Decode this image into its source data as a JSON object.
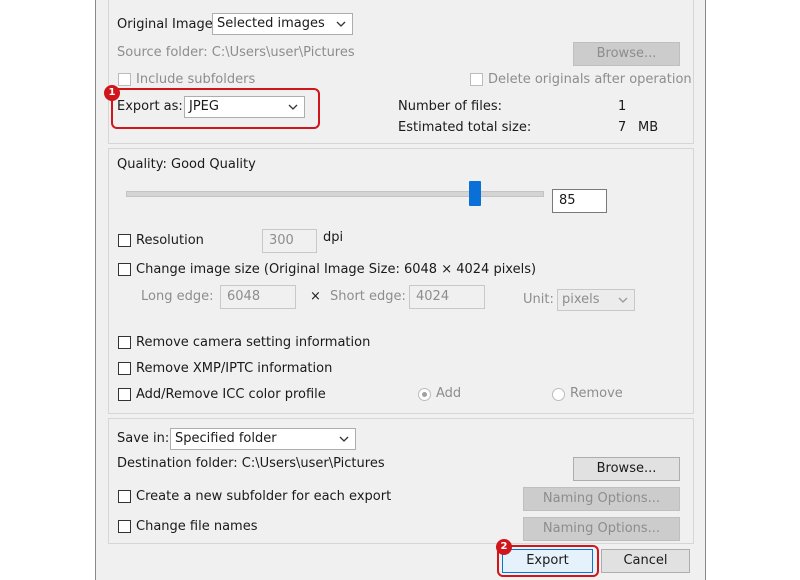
{
  "top": {
    "original_image_label": "Original Image:",
    "original_image_value": "Selected images",
    "source_folder": "Source folder: C:\\Users\\user\\Pictures",
    "browse_label": "Browse...",
    "include_subfolders": "Include subfolders",
    "delete_originals": "Delete originals after operation",
    "export_as_label": "Export as:",
    "export_as_value": "JPEG",
    "num_files_label": "Number of files:",
    "num_files_value": "1",
    "est_size_label": "Estimated total size:",
    "est_size_value": "7",
    "est_size_unit": "MB"
  },
  "quality": {
    "label": "Quality: Good Quality",
    "value": "85",
    "slider_value": 85,
    "resolution_label": "Resolution",
    "resolution_value": "300",
    "resolution_unit": "dpi",
    "change_size_label": "Change image size (Original Image Size: 6048 × 4024 pixels)",
    "long_edge_label": "Long edge:",
    "long_edge_value": "6048",
    "times": "×",
    "short_edge_label": "Short edge:",
    "short_edge_value": "4024",
    "unit_label": "Unit:",
    "unit_value": "pixels",
    "remove_camera": "Remove camera setting information",
    "remove_xmp": "Remove XMP/IPTC information",
    "icc_label": "Add/Remove ICC color profile",
    "add_label": "Add",
    "remove_label": "Remove"
  },
  "save": {
    "save_in_label": "Save in:",
    "save_in_value": "Specified folder",
    "destination": "Destination folder: C:\\Users\\user\\Pictures",
    "browse_label": "Browse...",
    "subfolder_label": "Create a new subfolder for each export",
    "naming_options_1": "Naming Options...",
    "change_names_label": "Change file names",
    "naming_options_2": "Naming Options..."
  },
  "footer": {
    "export_label": "Export",
    "cancel_label": "Cancel"
  },
  "annotations": {
    "badge_1": "1",
    "badge_2": "2",
    "highlight_color": "#d0161b"
  }
}
